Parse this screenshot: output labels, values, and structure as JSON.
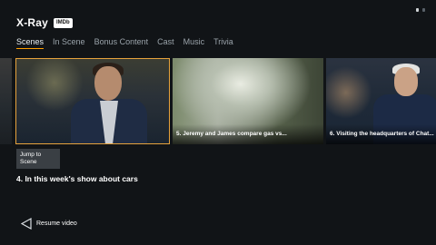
{
  "header": {
    "title": "X-Ray",
    "imdb_badge": "IMDb"
  },
  "tabs": [
    {
      "label": "Scenes",
      "active": true
    },
    {
      "label": "In Scene"
    },
    {
      "label": "Bonus Content"
    },
    {
      "label": "Cast"
    },
    {
      "label": "Music"
    },
    {
      "label": "Trivia"
    }
  ],
  "scenes": {
    "selected_caption": "",
    "card2_caption": "5. Jeremy and James compare gas vs...",
    "card3_caption": "6. Visiting the headquarters of Chat..."
  },
  "jump_button": {
    "label": "Jump to Scene"
  },
  "selected_title": "4. In this week's show about cars",
  "resume": {
    "label": "Resume video"
  },
  "colors": {
    "accent": "#e6a23c",
    "background": "#111417"
  },
  "icons": {
    "resume": "back-triangle-icon"
  }
}
